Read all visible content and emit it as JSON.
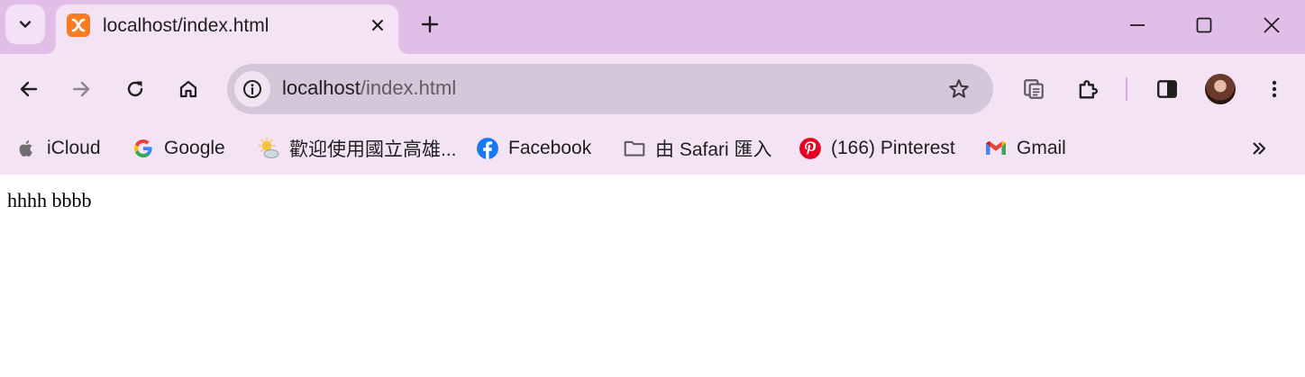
{
  "tab": {
    "title": "localhost/index.html"
  },
  "omnibox": {
    "host": "localhost",
    "path": "/index.html"
  },
  "bookmarks": [
    {
      "label": "iCloud",
      "icon": "apple-icon"
    },
    {
      "label": "Google",
      "icon": "google-icon"
    },
    {
      "label": "歡迎使用國立高雄...",
      "icon": "weather-sun-cloud-icon"
    },
    {
      "label": "Facebook",
      "icon": "facebook-icon"
    },
    {
      "label": "由 Safari 匯入",
      "icon": "folder-icon"
    },
    {
      "label": "(166) Pinterest",
      "icon": "pinterest-icon"
    },
    {
      "label": "Gmail",
      "icon": "gmail-icon"
    }
  ],
  "page": {
    "text": "hhhh bbbb"
  },
  "colors": {
    "tabstrip": "#e1bee7",
    "toolbar": "#f3e3f5",
    "omnibox": "#d6c6da",
    "favicon": "#fb7a24"
  }
}
